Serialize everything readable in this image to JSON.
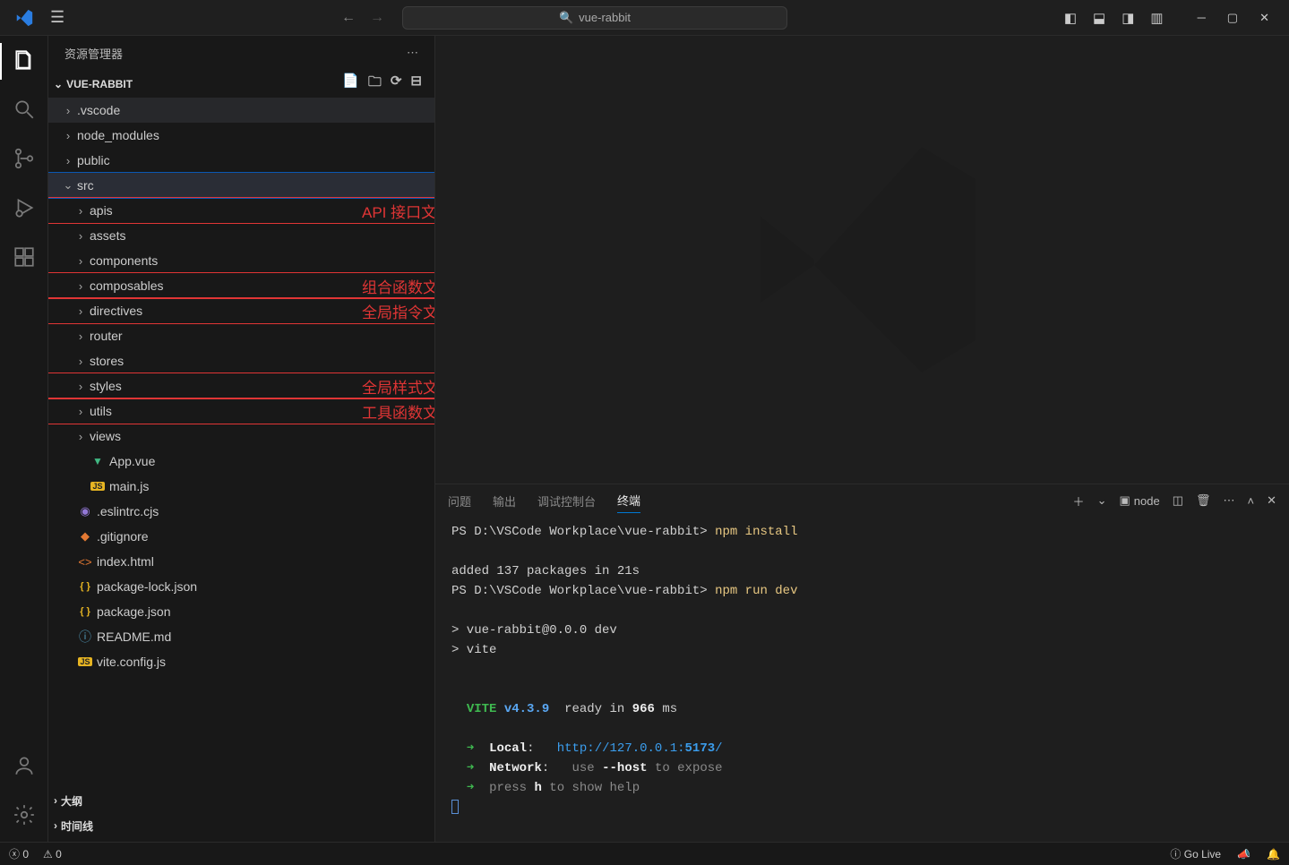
{
  "title_search": "vue-rabbit",
  "sidebar": {
    "title": "资源管理器",
    "project": "VUE-RABBIT",
    "outline": "大纲",
    "timeline": "时间线"
  },
  "tree": {
    "items": [
      {
        "label": ".vscode",
        "type": "folder",
        "depth": 1,
        "expanded": false,
        "redbox": false
      },
      {
        "label": "node_modules",
        "type": "folder",
        "depth": 1,
        "expanded": false,
        "redbox": false
      },
      {
        "label": "public",
        "type": "folder",
        "depth": 1,
        "expanded": false,
        "redbox": false
      },
      {
        "label": "src",
        "type": "folder",
        "depth": 1,
        "expanded": true,
        "redbox": false,
        "selected": true
      },
      {
        "label": "apis",
        "type": "folder",
        "depth": 2,
        "expanded": false,
        "redbox": true,
        "annotation": "API 接口文件夹"
      },
      {
        "label": "assets",
        "type": "folder",
        "depth": 2,
        "expanded": false,
        "redbox": false
      },
      {
        "label": "components",
        "type": "folder",
        "depth": 2,
        "expanded": false,
        "redbox": false
      },
      {
        "label": "composables",
        "type": "folder",
        "depth": 2,
        "expanded": false,
        "redbox": true,
        "annotation": "组合函数文件夹"
      },
      {
        "label": "directives",
        "type": "folder",
        "depth": 2,
        "expanded": false,
        "redbox": true,
        "annotation": "全局指令文件夹"
      },
      {
        "label": "router",
        "type": "folder",
        "depth": 2,
        "expanded": false,
        "redbox": false
      },
      {
        "label": "stores",
        "type": "folder",
        "depth": 2,
        "expanded": false,
        "redbox": false
      },
      {
        "label": "styles",
        "type": "folder",
        "depth": 2,
        "expanded": false,
        "redbox": true,
        "annotation": "全局样式文件夹"
      },
      {
        "label": "utils",
        "type": "folder",
        "depth": 2,
        "expanded": false,
        "redbox": true,
        "annotation": "工具函数文件夹"
      },
      {
        "label": "views",
        "type": "folder",
        "depth": 2,
        "expanded": false,
        "redbox": false
      },
      {
        "label": "App.vue",
        "type": "vue",
        "depth": 2,
        "redbox": false
      },
      {
        "label": "main.js",
        "type": "js",
        "depth": 2,
        "redbox": false
      },
      {
        "label": ".eslintrc.cjs",
        "type": "eslint",
        "depth": 1,
        "redbox": false
      },
      {
        "label": ".gitignore",
        "type": "git",
        "depth": 1,
        "redbox": false
      },
      {
        "label": "index.html",
        "type": "html",
        "depth": 1,
        "redbox": false
      },
      {
        "label": "package-lock.json",
        "type": "json",
        "depth": 1,
        "redbox": false
      },
      {
        "label": "package.json",
        "type": "json",
        "depth": 1,
        "redbox": false
      },
      {
        "label": "README.md",
        "type": "md",
        "depth": 1,
        "redbox": false
      },
      {
        "label": "vite.config.js",
        "type": "js",
        "depth": 1,
        "redbox": false
      }
    ]
  },
  "panel": {
    "tabs": [
      "问题",
      "输出",
      "调试控制台",
      "终端"
    ],
    "active_tab": "终端",
    "terminal_label": "node"
  },
  "terminal": {
    "lines": [
      {
        "type": "prompt",
        "path": "PS D:\\VSCode Workplace\\vue-rabbit>",
        "cmd": "npm install"
      },
      {
        "type": "blank"
      },
      {
        "type": "plain",
        "text": "added 137 packages in 21s"
      },
      {
        "type": "prompt",
        "path": "PS D:\\VSCode Workplace\\vue-rabbit>",
        "cmd": "npm run dev"
      },
      {
        "type": "blank"
      },
      {
        "type": "plain",
        "text": "> vue-rabbit@0.0.0 dev"
      },
      {
        "type": "plain",
        "text": "> vite"
      },
      {
        "type": "blank"
      },
      {
        "type": "blank"
      },
      {
        "type": "vite",
        "label": "VITE",
        "version": "v4.3.9",
        "rest": "ready in",
        "ms": "966",
        "unit": "ms"
      },
      {
        "type": "blank"
      },
      {
        "type": "arrow",
        "label": "Local",
        "sep": ":",
        "url_text": "http://127.0.0.1:",
        "port": "5173",
        "trail": "/"
      },
      {
        "type": "arrow",
        "label": "Network",
        "sep": ":",
        "muted": "use",
        "bold": "--host",
        "tail": "to expose"
      },
      {
        "type": "arrow",
        "plain": "press",
        "bold": "h",
        "tail": "to show help"
      },
      {
        "type": "cursor"
      }
    ]
  },
  "statusbar": {
    "errors": "0",
    "warnings": "0",
    "golive": "Go Live"
  }
}
